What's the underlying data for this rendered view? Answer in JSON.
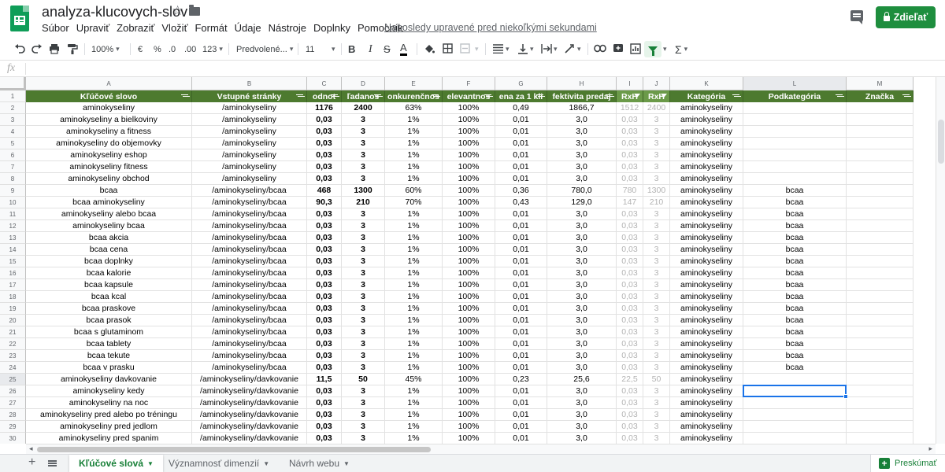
{
  "header": {
    "doc_title": "analyza-klucovych-slov",
    "menu": [
      "Súbor",
      "Upraviť",
      "Zobraziť",
      "Vložiť",
      "Formát",
      "Údaje",
      "Nástroje",
      "Doplnky",
      "Pomocník"
    ],
    "last_edit": "Naposledy upravené pred niekoľkými sekundami",
    "share_label": "Zdieľať"
  },
  "toolbar": {
    "zoom": "100%",
    "currency": "€",
    "percent": "%",
    "dec_less": ".0",
    "dec_more": ".00",
    "more_formats": "123",
    "font": "Predvolené...",
    "font_size": "11",
    "bold": "B",
    "italic": "I",
    "strike": "S",
    "text_color": "A",
    "sigma": "Σ"
  },
  "formula_bar": {
    "fx": "fx",
    "value": ""
  },
  "colors": {
    "header_green": "#4d7a2f",
    "accent_green": "#188038",
    "selection_blue": "#1a73e8"
  },
  "sheet": {
    "columns": [
      "A",
      "B",
      "C",
      "D",
      "E",
      "F",
      "G",
      "H",
      "I",
      "J",
      "K",
      "L",
      "M"
    ],
    "headers": [
      "Kľúčové slovo",
      "Vstupné stránky",
      "odnot",
      "ľadanos",
      "onkurenčnos",
      "elevantnos",
      "ena za 1 kli",
      "fektivita predaj",
      "RxH",
      "RxH",
      "Kategória",
      "Podkategória",
      "Značka"
    ],
    "row_numbers": [
      "1",
      "2",
      "3",
      "4",
      "5",
      "6",
      "7",
      "8",
      "9",
      "10",
      "11",
      "12",
      "13",
      "14",
      "15",
      "16",
      "17",
      "18",
      "19",
      "20",
      "21",
      "22",
      "23",
      "24",
      "25",
      "26",
      "27",
      "28",
      "29",
      "30"
    ],
    "rows": [
      [
        "aminokyseliny",
        "/aminokyseliny",
        "1176",
        "2400",
        "63%",
        "100%",
        "0,49",
        "1866,7",
        "1512",
        "2400",
        "aminokyseliny",
        "",
        ""
      ],
      [
        "aminokyseliny a bielkoviny",
        "/aminokyseliny",
        "0,03",
        "3",
        "1%",
        "100%",
        "0,01",
        "3,0",
        "0,03",
        "3",
        "aminokyseliny",
        "",
        ""
      ],
      [
        "aminokyseliny a fitness",
        "/aminokyseliny",
        "0,03",
        "3",
        "1%",
        "100%",
        "0,01",
        "3,0",
        "0,03",
        "3",
        "aminokyseliny",
        "",
        ""
      ],
      [
        "aminokyseliny do objemovky",
        "/aminokyseliny",
        "0,03",
        "3",
        "1%",
        "100%",
        "0,01",
        "3,0",
        "0,03",
        "3",
        "aminokyseliny",
        "",
        ""
      ],
      [
        "aminokyseliny eshop",
        "/aminokyseliny",
        "0,03",
        "3",
        "1%",
        "100%",
        "0,01",
        "3,0",
        "0,03",
        "3",
        "aminokyseliny",
        "",
        ""
      ],
      [
        "aminokyseliny fitness",
        "/aminokyseliny",
        "0,03",
        "3",
        "1%",
        "100%",
        "0,01",
        "3,0",
        "0,03",
        "3",
        "aminokyseliny",
        "",
        ""
      ],
      [
        "aminokyseliny obchod",
        "/aminokyseliny",
        "0,03",
        "3",
        "1%",
        "100%",
        "0,01",
        "3,0",
        "0,03",
        "3",
        "aminokyseliny",
        "",
        ""
      ],
      [
        "bcaa",
        "/aminokyseliny/bcaa",
        "468",
        "1300",
        "60%",
        "100%",
        "0,36",
        "780,0",
        "780",
        "1300",
        "aminokyseliny",
        "bcaa",
        ""
      ],
      [
        "bcaa aminokyseliny",
        "/aminokyseliny/bcaa",
        "90,3",
        "210",
        "70%",
        "100%",
        "0,43",
        "129,0",
        "147",
        "210",
        "aminokyseliny",
        "bcaa",
        ""
      ],
      [
        "aminokyseliny alebo bcaa",
        "/aminokyseliny/bcaa",
        "0,03",
        "3",
        "1%",
        "100%",
        "0,01",
        "3,0",
        "0,03",
        "3",
        "aminokyseliny",
        "bcaa",
        ""
      ],
      [
        "aminokyseliny bcaa",
        "/aminokyseliny/bcaa",
        "0,03",
        "3",
        "1%",
        "100%",
        "0,01",
        "3,0",
        "0,03",
        "3",
        "aminokyseliny",
        "bcaa",
        ""
      ],
      [
        "bcaa akcia",
        "/aminokyseliny/bcaa",
        "0,03",
        "3",
        "1%",
        "100%",
        "0,01",
        "3,0",
        "0,03",
        "3",
        "aminokyseliny",
        "bcaa",
        ""
      ],
      [
        "bcaa cena",
        "/aminokyseliny/bcaa",
        "0,03",
        "3",
        "1%",
        "100%",
        "0,01",
        "3,0",
        "0,03",
        "3",
        "aminokyseliny",
        "bcaa",
        ""
      ],
      [
        "bcaa doplnky",
        "/aminokyseliny/bcaa",
        "0,03",
        "3",
        "1%",
        "100%",
        "0,01",
        "3,0",
        "0,03",
        "3",
        "aminokyseliny",
        "bcaa",
        ""
      ],
      [
        "bcaa kalorie",
        "/aminokyseliny/bcaa",
        "0,03",
        "3",
        "1%",
        "100%",
        "0,01",
        "3,0",
        "0,03",
        "3",
        "aminokyseliny",
        "bcaa",
        ""
      ],
      [
        "bcaa kapsule",
        "/aminokyseliny/bcaa",
        "0,03",
        "3",
        "1%",
        "100%",
        "0,01",
        "3,0",
        "0,03",
        "3",
        "aminokyseliny",
        "bcaa",
        ""
      ],
      [
        "bcaa kcal",
        "/aminokyseliny/bcaa",
        "0,03",
        "3",
        "1%",
        "100%",
        "0,01",
        "3,0",
        "0,03",
        "3",
        "aminokyseliny",
        "bcaa",
        ""
      ],
      [
        "bcaa praskove",
        "/aminokyseliny/bcaa",
        "0,03",
        "3",
        "1%",
        "100%",
        "0,01",
        "3,0",
        "0,03",
        "3",
        "aminokyseliny",
        "bcaa",
        ""
      ],
      [
        "bcaa prasok",
        "/aminokyseliny/bcaa",
        "0,03",
        "3",
        "1%",
        "100%",
        "0,01",
        "3,0",
        "0,03",
        "3",
        "aminokyseliny",
        "bcaa",
        ""
      ],
      [
        "bcaa s glutaminom",
        "/aminokyseliny/bcaa",
        "0,03",
        "3",
        "1%",
        "100%",
        "0,01",
        "3,0",
        "0,03",
        "3",
        "aminokyseliny",
        "bcaa",
        ""
      ],
      [
        "bcaa tablety",
        "/aminokyseliny/bcaa",
        "0,03",
        "3",
        "1%",
        "100%",
        "0,01",
        "3,0",
        "0,03",
        "3",
        "aminokyseliny",
        "bcaa",
        ""
      ],
      [
        "bcaa tekute",
        "/aminokyseliny/bcaa",
        "0,03",
        "3",
        "1%",
        "100%",
        "0,01",
        "3,0",
        "0,03",
        "3",
        "aminokyseliny",
        "bcaa",
        ""
      ],
      [
        "bcaa v prasku",
        "/aminokyseliny/bcaa",
        "0,03",
        "3",
        "1%",
        "100%",
        "0,01",
        "3,0",
        "0,03",
        "3",
        "aminokyseliny",
        "bcaa",
        ""
      ],
      [
        "aminokyseliny davkovanie",
        "/aminokyseliny/davkovanie",
        "11,5",
        "50",
        "45%",
        "100%",
        "0,23",
        "25,6",
        "22,5",
        "50",
        "aminokyseliny",
        "",
        ""
      ],
      [
        "aminokyseliny kedy",
        "/aminokyseliny/davkovanie",
        "0,03",
        "3",
        "1%",
        "100%",
        "0,01",
        "3,0",
        "0,03",
        "3",
        "aminokyseliny",
        "",
        ""
      ],
      [
        "aminokyseliny na noc",
        "/aminokyseliny/davkovanie",
        "0,03",
        "3",
        "1%",
        "100%",
        "0,01",
        "3,0",
        "0,03",
        "3",
        "aminokyseliny",
        "",
        ""
      ],
      [
        "aminokyseliny pred alebo po tréningu",
        "/aminokyseliny/davkovanie",
        "0,03",
        "3",
        "1%",
        "100%",
        "0,01",
        "3,0",
        "0,03",
        "3",
        "aminokyseliny",
        "",
        ""
      ],
      [
        "aminokyseliny pred jedlom",
        "/aminokyseliny/davkovanie",
        "0,03",
        "3",
        "1%",
        "100%",
        "0,01",
        "3,0",
        "0,03",
        "3",
        "aminokyseliny",
        "",
        ""
      ],
      [
        "aminokyseliny pred spanim",
        "/aminokyseliny/davkovanie",
        "0,03",
        "3",
        "1%",
        "100%",
        "0,01",
        "3,0",
        "0,03",
        "3",
        "aminokyseliny",
        "",
        ""
      ]
    ]
  },
  "sheet_tabs": [
    {
      "label": "Kľúčové slová",
      "active": true
    },
    {
      "label": "Významnosť dimenzií",
      "active": false
    },
    {
      "label": "Návrh webu",
      "active": false
    }
  ],
  "explore_label": "Preskúmať"
}
